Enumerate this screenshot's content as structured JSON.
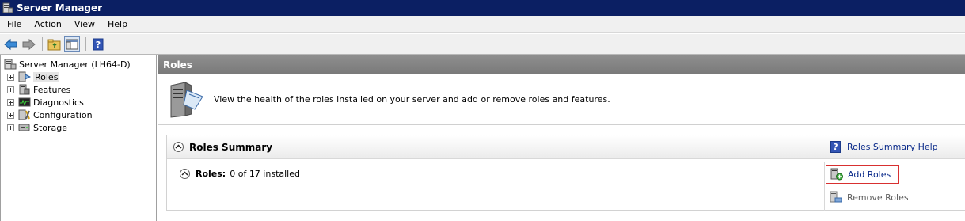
{
  "window": {
    "title": "Server Manager"
  },
  "menu": [
    "File",
    "Action",
    "View",
    "Help"
  ],
  "toolbar": {
    "buttons": [
      "back-arrow-icon",
      "forward-arrow-icon",
      "up-folder-icon",
      "show-hide-console-tree-icon",
      "help-icon"
    ]
  },
  "tree": {
    "root": "Server Manager (LH64-D)",
    "items": [
      {
        "label": "Roles",
        "selected": true
      },
      {
        "label": "Features",
        "selected": false
      },
      {
        "label": "Diagnostics",
        "selected": false
      },
      {
        "label": "Configuration",
        "selected": false
      },
      {
        "label": "Storage",
        "selected": false
      }
    ]
  },
  "content": {
    "header": "Roles",
    "intro": "View the health of the roles installed on your server and add or remove roles and features.",
    "summary": {
      "title": "Roles Summary",
      "help_link": "Roles Summary Help",
      "roles_label": "Roles:",
      "roles_value": "0 of 17 installed",
      "actions": {
        "add": "Add Roles",
        "remove": "Remove Roles"
      }
    }
  },
  "colors": {
    "titlebar": "#0b1f63",
    "header": "#8a8a8a",
    "link": "#0a2a8a",
    "highlight_border": "#d83030"
  }
}
